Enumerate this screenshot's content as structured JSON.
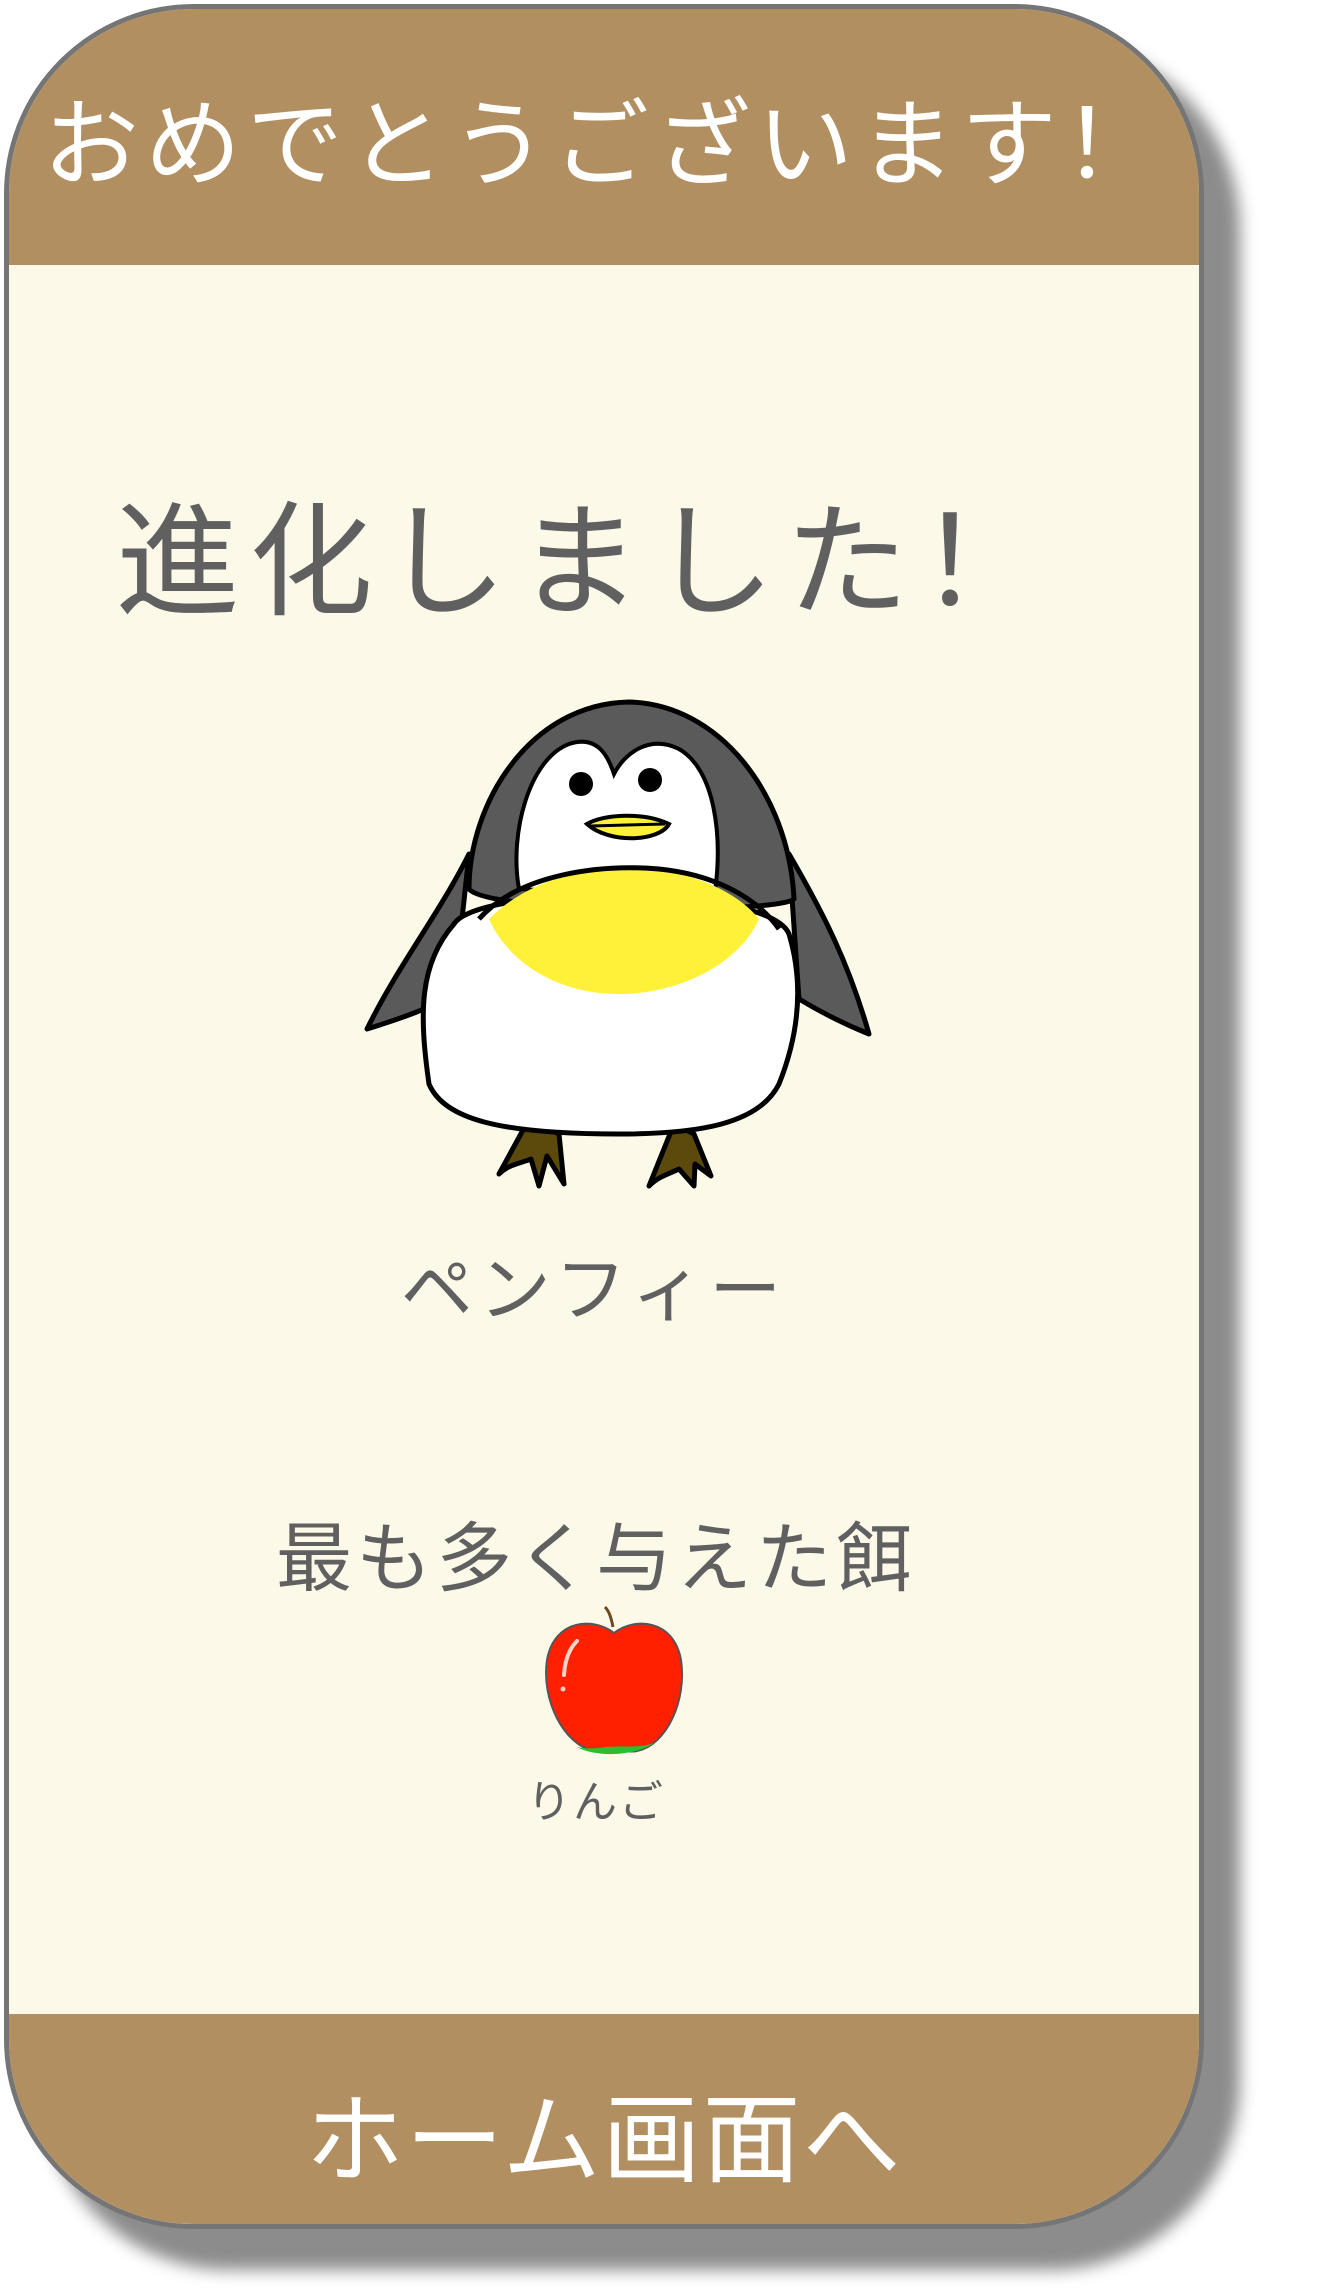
{
  "header": {
    "title": "おめでとうございます！"
  },
  "main": {
    "evolved_message": "進化しました！",
    "pet_name": "ペンフィー",
    "most_fed_label": "最も多く与えた餌",
    "most_fed_food": "りんご"
  },
  "footer": {
    "home_button_label": "ホーム画面へ"
  },
  "icons": {
    "pet": "penguin-character",
    "food": "apple-icon"
  },
  "colors": {
    "header_bg": "#b28f61",
    "card_bg": "#fcf9e9",
    "text": "#606060",
    "header_text": "#ffffff"
  }
}
